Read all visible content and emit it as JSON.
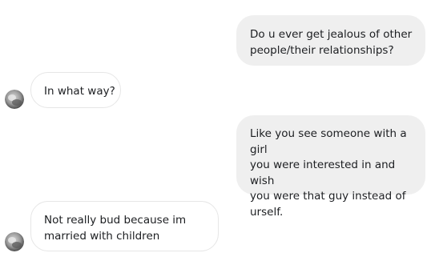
{
  "messages": [
    {
      "direction": "sent",
      "text": "Do u ever get jealous of other\npeople/their relationships?"
    },
    {
      "direction": "received",
      "text": "In what way?",
      "avatar_icon": "user-avatar"
    },
    {
      "direction": "sent",
      "text": "Like you see someone with a girl\nyou were interested in and wish\nyou were that guy instead of\nurself."
    },
    {
      "direction": "received",
      "text": "Not really bud because im\nmarried with children",
      "avatar_icon": "user-avatar"
    }
  ],
  "colors": {
    "sent_bubble": "#efefef",
    "received_bubble": "#ffffff",
    "received_border": "#e6e6e6",
    "text": "#1c1e21"
  }
}
